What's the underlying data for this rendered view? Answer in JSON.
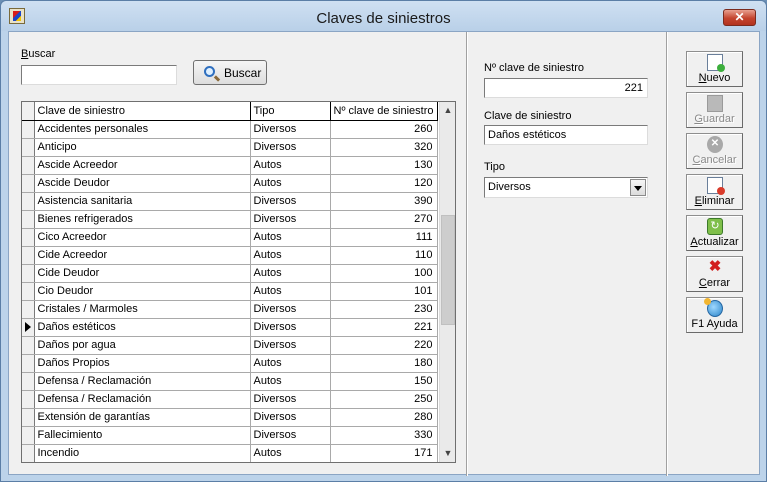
{
  "window": {
    "title": "Claves de siniestros",
    "close_glyph": "✕"
  },
  "search": {
    "label_first": "B",
    "label_rest": "uscar",
    "value": "",
    "button_label": "Buscar"
  },
  "grid": {
    "columns": [
      "Clave de siniestro",
      "Tipo",
      "Nº clave de siniestro"
    ],
    "current_row_index": 11,
    "rows": [
      [
        "Accidentes personales",
        "Diversos",
        "260"
      ],
      [
        "Anticipo",
        "Diversos",
        "320"
      ],
      [
        "Ascide Acreedor",
        "Autos",
        "130"
      ],
      [
        "Ascide Deudor",
        "Autos",
        "120"
      ],
      [
        "Asistencia sanitaria",
        "Diversos",
        "390"
      ],
      [
        "Bienes refrigerados",
        "Diversos",
        "270"
      ],
      [
        "Cico Acreedor",
        "Autos",
        "111"
      ],
      [
        "Cide Acreedor",
        "Autos",
        "110"
      ],
      [
        "Cide Deudor",
        "Autos",
        "100"
      ],
      [
        "Cio Deudor",
        "Autos",
        "101"
      ],
      [
        "Cristales / Marmoles",
        "Diversos",
        "230"
      ],
      [
        "Daños estéticos",
        "Diversos",
        "221"
      ],
      [
        "Daños por agua",
        "Diversos",
        "220"
      ],
      [
        "Daños Propios",
        "Autos",
        "180"
      ],
      [
        "Defensa / Reclamación",
        "Autos",
        "150"
      ],
      [
        "Defensa / Reclamación",
        "Diversos",
        "250"
      ],
      [
        "Extensión de garantías",
        "Diversos",
        "280"
      ],
      [
        "Fallecimiento",
        "Diversos",
        "330"
      ],
      [
        "Incendio",
        "Autos",
        "171"
      ]
    ]
  },
  "detail": {
    "numero_label": "Nº clave de siniestro",
    "numero_value": "221",
    "clave_label": "Clave de siniestro",
    "clave_value": "Daños estéticos",
    "tipo_label": "Tipo",
    "tipo_value": "Diversos"
  },
  "toolbar": {
    "nuevo": {
      "first": "N",
      "rest": "uevo"
    },
    "guardar": {
      "first": "G",
      "rest": "uardar"
    },
    "cancelar": {
      "first": "C",
      "rest": "ancelar"
    },
    "eliminar": {
      "first": "E",
      "rest": "liminar"
    },
    "actualizar": {
      "first": "A",
      "rest": "ctualizar"
    },
    "cerrar": {
      "first": "C",
      "rest": "errar"
    },
    "ayuda": "F1 Ayuda"
  }
}
